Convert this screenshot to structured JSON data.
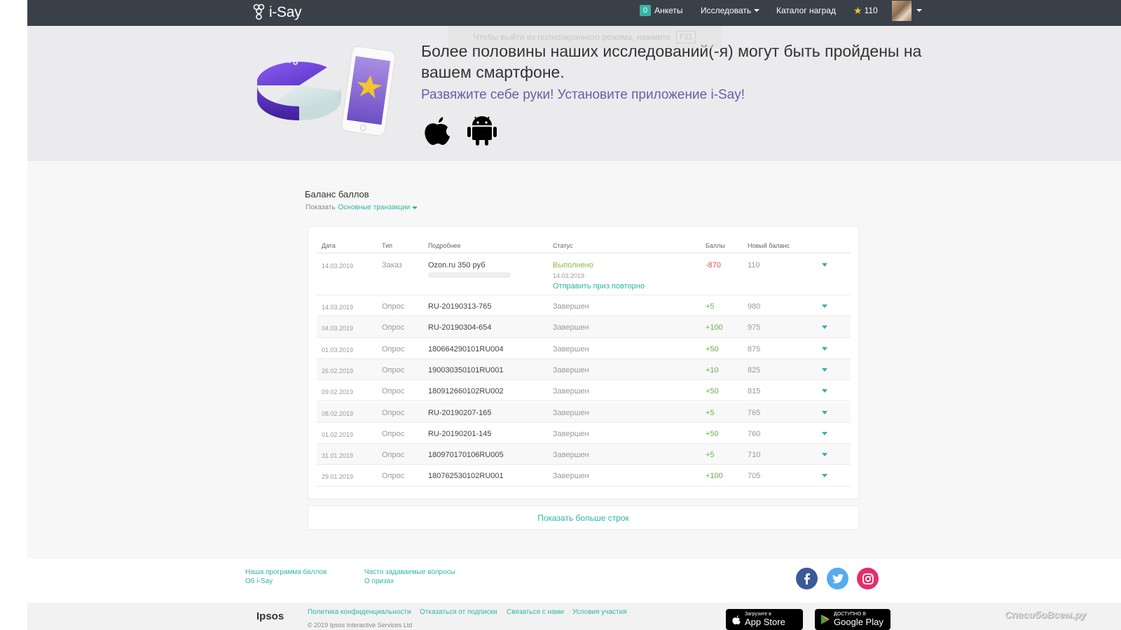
{
  "header": {
    "logo_text": "i-Say",
    "surveys_count": "0",
    "surveys_label": "Анкеты",
    "research_label": "Исследовать",
    "catalog_label": "Каталог наград",
    "points": "110"
  },
  "fullscreen_notice": {
    "text": "Чтобы выйти из полноэкранного режима, нажмите",
    "key": "F11"
  },
  "promo": {
    "art_label": "50%",
    "headline": "Более половины наших исследований(-я) могут быть пройдены на вашем смартфоне.",
    "subline": "Развяжите себе руки! Установите приложение i-Say!"
  },
  "balance": {
    "title": "Баланс баллов",
    "show_label": "Показать",
    "filter_value": "Основные транзакции"
  },
  "table": {
    "headers": [
      "Дата",
      "Тип",
      "Подробнее",
      "Статус",
      "Баллы",
      "Новый баланс"
    ],
    "order": {
      "date": "14.03.2019",
      "type": "Заказ",
      "detail": "Ozon.ru 350 руб",
      "status": "Выполнено",
      "status_date": "14.03.2019",
      "resend": "Отправить приз повторно",
      "points": "-870",
      "balance": "110"
    },
    "rows": [
      {
        "date": "14.03.2019",
        "type": "Опрос",
        "detail": "RU-20190313-765",
        "status": "Завершен",
        "points": "+5",
        "balance": "980"
      },
      {
        "date": "04.03.2019",
        "type": "Опрос",
        "detail": "RU-20190304-654",
        "status": "Завершен",
        "points": "+100",
        "balance": "975"
      },
      {
        "date": "01.03.2019",
        "type": "Опрос",
        "detail": "180664290101RU004",
        "status": "Завершен",
        "points": "+50",
        "balance": "875"
      },
      {
        "date": "26.02.2019",
        "type": "Опрос",
        "detail": "190030350101RU001",
        "status": "Завершен",
        "points": "+10",
        "balance": "825"
      },
      {
        "date": "09.02.2019",
        "type": "Опрос",
        "detail": "180912660102RU002",
        "status": "Завершен",
        "points": "+50",
        "balance": "815"
      },
      {
        "date": "08.02.2019",
        "type": "Опрос",
        "detail": "RU-20190207-165",
        "status": "Завершен",
        "points": "+5",
        "balance": "765"
      },
      {
        "date": "01.02.2019",
        "type": "Опрос",
        "detail": "RU-20190201-145",
        "status": "Завершен",
        "points": "+50",
        "balance": "760"
      },
      {
        "date": "31.01.2019",
        "type": "Опрос",
        "detail": "180970170106RU005",
        "status": "Завершен",
        "points": "+5",
        "balance": "710"
      },
      {
        "date": "29.01.2019",
        "type": "Опрос",
        "detail": "180762530102RU001",
        "status": "Завершен",
        "points": "+100",
        "balance": "705"
      }
    ],
    "show_more": "Показать больше строк"
  },
  "footer": {
    "links_col1": [
      "Наша программа баллов",
      "Об i-Say"
    ],
    "links_col2": [
      "Часто задаваемые вопросы",
      "О призах"
    ],
    "legal_links": [
      "Политика конфиденциальности",
      "Отказаться от подписки",
      "Связаться с нами",
      "Условия участия"
    ],
    "brand": "Ipsos",
    "copyright": "© 2019 Ipsos Interactive Services Ltd",
    "appstore_small": "Загрузите в",
    "appstore_big": "App Store",
    "googleplay_small": "ДОСТУПНО В",
    "googleplay_big": "Google Play",
    "social": [
      "facebook-icon",
      "twitter-icon",
      "instagram-icon"
    ]
  },
  "watermark": "СпасибоВсем.ру",
  "colors": {
    "accent": "#2cb5a5",
    "topbar": "#3a4048",
    "promo_purple": "#6b5ba8",
    "negative": "#e2523b",
    "positive": "#6ab04c"
  }
}
